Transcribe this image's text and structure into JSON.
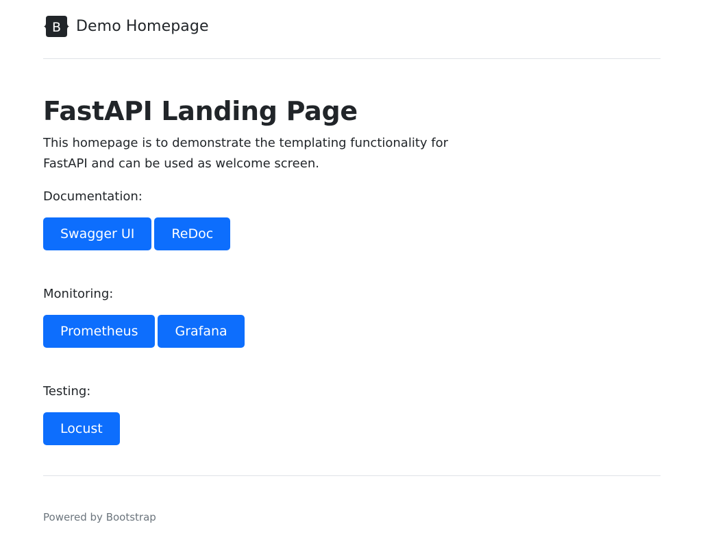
{
  "header": {
    "brand_text": "Demo Homepage",
    "logo_letter": "B",
    "logo_icon": "bootstrap-logo-icon"
  },
  "hero": {
    "title": "FastAPI Landing Page",
    "lead": "This homepage is to demonstrate the templating functionality for FastAPI and can be used as welcome screen."
  },
  "sections": {
    "documentation": {
      "label": "Documentation:",
      "buttons": [
        "Swagger UI",
        "ReDoc"
      ]
    },
    "monitoring": {
      "label": "Monitoring:",
      "buttons": [
        "Prometheus",
        "Grafana"
      ]
    },
    "testing": {
      "label": "Testing:",
      "buttons": [
        "Locust"
      ]
    }
  },
  "footer": {
    "text": "Powered by Bootstrap"
  },
  "colors": {
    "primary": "#0d6efd",
    "text": "#212529",
    "muted": "#6c757d",
    "border": "#dee2e6"
  }
}
